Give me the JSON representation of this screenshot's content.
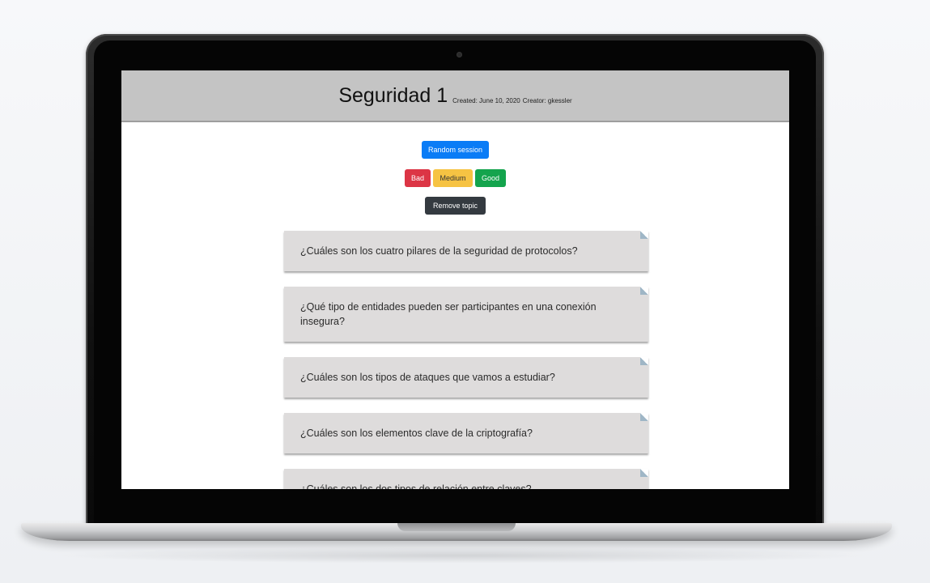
{
  "header": {
    "title": "Seguridad 1",
    "created": "Created: June 10, 2020",
    "creator": "Creator: gkessler"
  },
  "controls": {
    "random_session": "Random session",
    "bad": "Bad",
    "medium": "Medium",
    "good": "Good",
    "remove_topic": "Remove topic"
  },
  "colors": {
    "header_bg": "#c4c4c4",
    "primary": "#0a7cf6",
    "bad": "#dc3545",
    "medium": "#f6c343",
    "good": "#14a44d",
    "dark": "#343a40",
    "card_bg": "#dedcdc"
  },
  "cards": [
    {
      "question": "¿Cuáles son los cuatro pilares de la seguridad de protocolos?"
    },
    {
      "question": "¿Qué tipo de entidades pueden ser participantes en una conexión insegura?"
    },
    {
      "question": "¿Cuáles son los tipos de ataques que vamos a estudiar?"
    },
    {
      "question": "¿Cuáles son los elementos clave de la criptografía?"
    },
    {
      "question": "¿Cuáles son los dos tipos de relación entre claves?"
    }
  ]
}
